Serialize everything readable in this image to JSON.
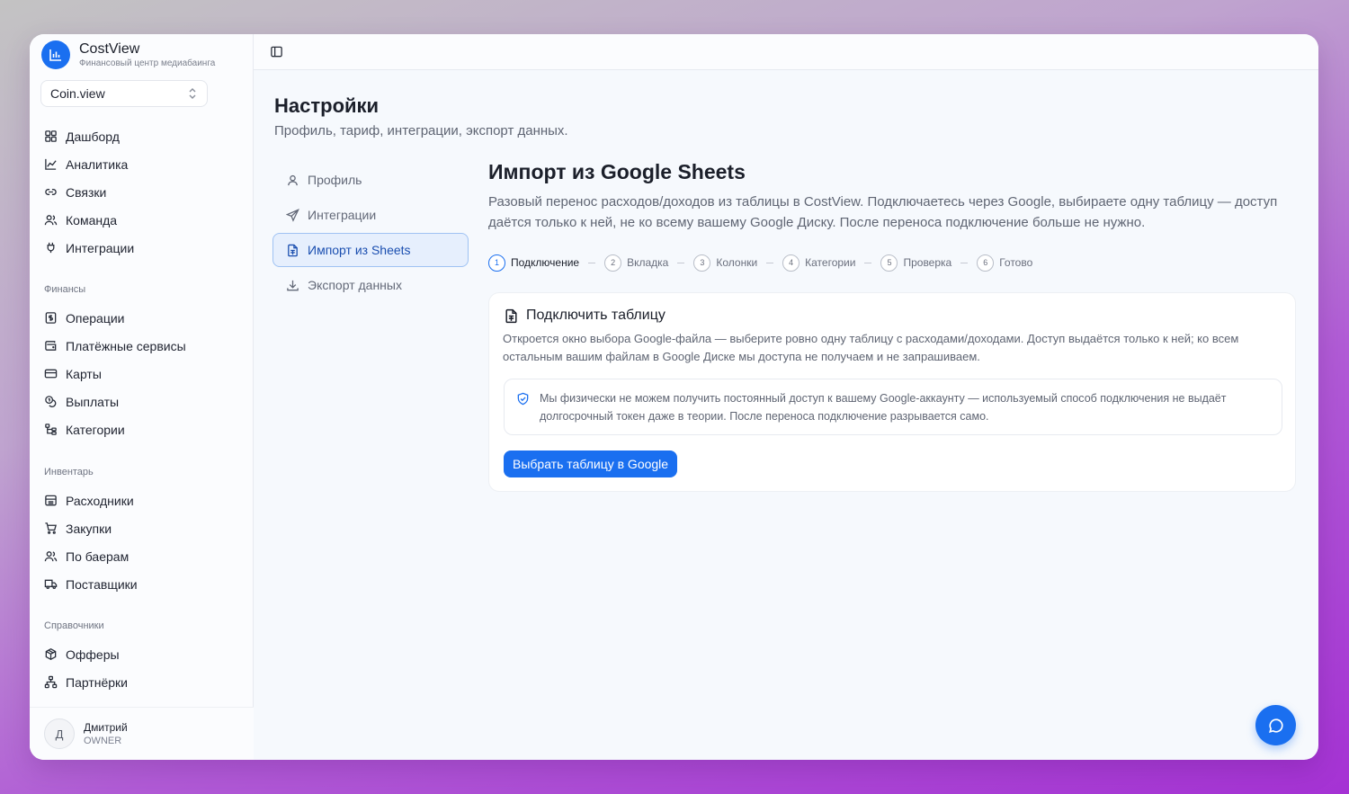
{
  "brand": {
    "name": "CostView",
    "subtitle": "Финансовый центр медиабаинга"
  },
  "workspace": {
    "name": "Coin.view"
  },
  "nav": {
    "main": [
      {
        "label": "Дашборд",
        "icon": "grid-icon"
      },
      {
        "label": "Аналитика",
        "icon": "chart-line-icon"
      },
      {
        "label": "Связки",
        "icon": "link-icon"
      },
      {
        "label": "Команда",
        "icon": "users-icon"
      },
      {
        "label": "Интеграции",
        "icon": "plug-icon"
      }
    ],
    "finance_head": "Финансы",
    "finance": [
      {
        "label": "Операции",
        "icon": "dollar-doc-icon"
      },
      {
        "label": "Платёжные сервисы",
        "icon": "wallet-icon"
      },
      {
        "label": "Карты",
        "icon": "card-icon"
      },
      {
        "label": "Выплаты",
        "icon": "coins-icon"
      },
      {
        "label": "Категории",
        "icon": "tree-icon"
      }
    ],
    "inventory_head": "Инвентарь",
    "inventory": [
      {
        "label": "Расходники",
        "icon": "box-icon"
      },
      {
        "label": "Закупки",
        "icon": "cart-icon"
      },
      {
        "label": "По баерам",
        "icon": "users-icon"
      },
      {
        "label": "Поставщики",
        "icon": "truck-icon"
      }
    ],
    "refs_head": "Справочники",
    "refs": [
      {
        "label": "Офферы",
        "icon": "package-icon"
      },
      {
        "label": "Партнёрки",
        "icon": "network-icon"
      }
    ]
  },
  "user": {
    "initial": "Д",
    "name": "Дмитрий",
    "role": "OWNER"
  },
  "page": {
    "title": "Настройки",
    "subtitle": "Профиль, тариф, интеграции, экспорт данных."
  },
  "subnav": [
    {
      "label": "Профиль",
      "icon": "user-icon",
      "active": false
    },
    {
      "label": "Интеграции",
      "icon": "send-icon",
      "active": false
    },
    {
      "label": "Импорт из Sheets",
      "icon": "sheet-icon",
      "active": true
    },
    {
      "label": "Экспорт данных",
      "icon": "download-icon",
      "active": false
    }
  ],
  "import": {
    "title": "Импорт из Google Sheets",
    "description": "Разовый перенос расходов/доходов из таблицы в CostView. Подключаетесь через Google, выбираете одну таблицу — доступ даётся только к ней, не ко всему вашему Google Диску. После переноса подключение больше не нужно.",
    "steps": [
      {
        "num": "1",
        "label": "Подключение",
        "active": true
      },
      {
        "num": "2",
        "label": "Вкладка",
        "active": false
      },
      {
        "num": "3",
        "label": "Колонки",
        "active": false
      },
      {
        "num": "4",
        "label": "Категории",
        "active": false
      },
      {
        "num": "5",
        "label": "Проверка",
        "active": false
      },
      {
        "num": "6",
        "label": "Готово",
        "active": false
      }
    ],
    "card": {
      "title": "Подключить таблицу",
      "description": "Откроется окно выбора Google-файла — выберите ровно одну таблицу с расходами/доходами. Доступ выдаётся только к ней; ко всем остальным вашим файлам в Google Диске мы доступа не получаем и не запрашиваем.",
      "notice": "Мы физически не можем получить постоянный доступ к вашему Google-аккаунту — используемый способ подключения не выдаёт долгосрочный токен даже в теории. После переноса подключение разрывается само.",
      "button": "Выбрать таблицу в Google"
    }
  },
  "colors": {
    "accent": "#1a6ff0"
  }
}
